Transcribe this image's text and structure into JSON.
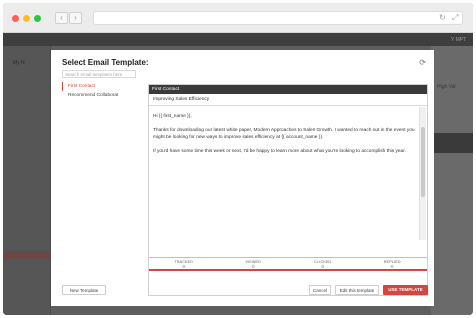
{
  "colors": {
    "accent": "#d8453c",
    "dark_header": "#3a3a3a"
  },
  "browser": {
    "traffic_lights": [
      "#ff5f57",
      "#febc2e",
      "#28c840"
    ],
    "back_glyph": "‹",
    "forward_glyph": "›",
    "reload_glyph": "↻",
    "expand_glyph": "⤢"
  },
  "background_app": {
    "sidebar_item": "My N",
    "right_text": "Y MPT",
    "right_text2": "High Val"
  },
  "modal": {
    "title": "Select Email Template:",
    "refresh_glyph": "⟳",
    "search_placeholder": "Search email templates here",
    "templates": [
      {
        "label": "First Contact",
        "active": true
      },
      {
        "label": "Recommend Collaborat",
        "active": false
      }
    ],
    "preview": {
      "header": "First Contact",
      "subject": "Improving Sales Efficiency",
      "body": [
        "Hi {{ first_name }},",
        "Thanks for downloading our latest white paper, Modern Approaches to Sales Growth. I wanted to reach out in the event you might be looking for new ways to improve sales efficiency at {{ account_name }}.",
        "If you'd have some time this week or next, I'd be happy to learn more about what you're looking to accomplish this year."
      ],
      "stats": [
        {
          "label": "TRACKED",
          "value": "0"
        },
        {
          "label": "VIEWED",
          "value": "0"
        },
        {
          "label": "CLICKED",
          "value": "0"
        },
        {
          "label": "REPLIED",
          "value": "0"
        }
      ]
    },
    "buttons": {
      "new_template": "New Template",
      "cancel": "Cancel",
      "edit": "Edit this template",
      "use": "USE TEMPLATE"
    }
  }
}
